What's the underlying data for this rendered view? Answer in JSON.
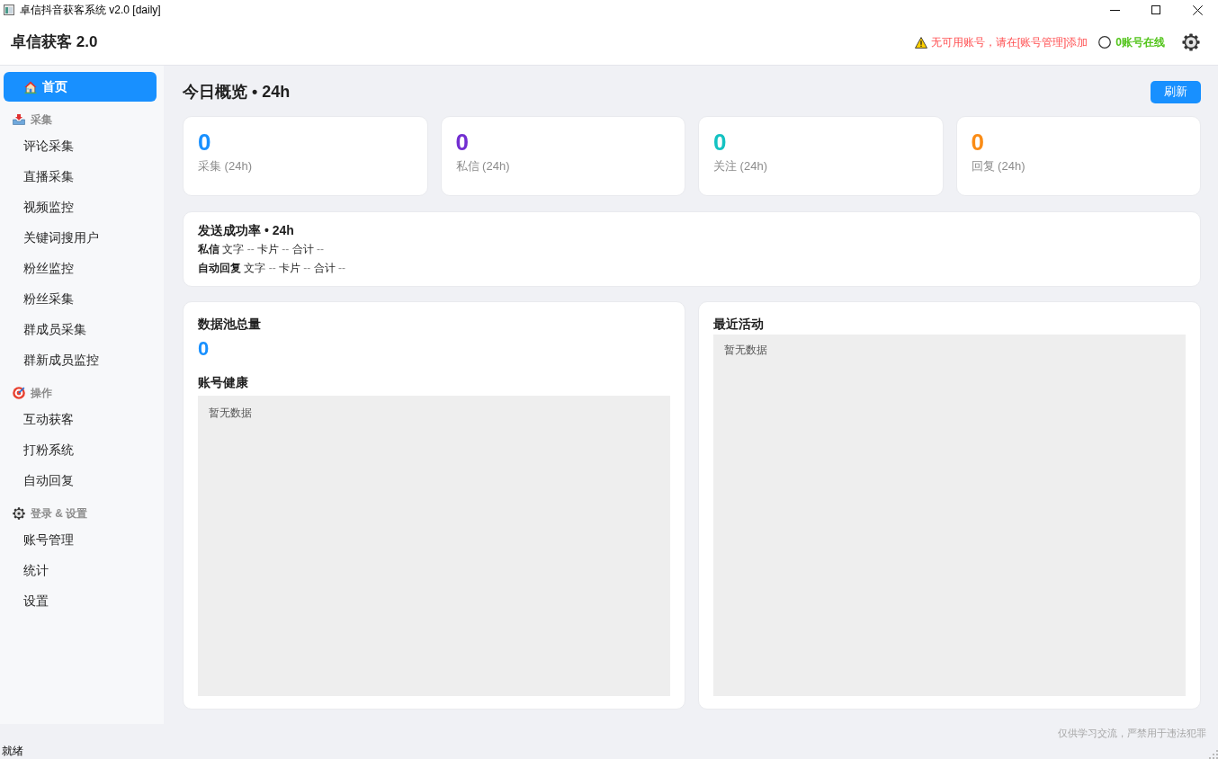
{
  "window": {
    "title": "卓信抖音获客系统 v2.0 [daily]"
  },
  "header": {
    "app_title": "卓信获客 2.0",
    "warning": "无可用账号，请在[账号管理]添加",
    "online_status": "0账号在线"
  },
  "sidebar": {
    "home": {
      "label": "首页",
      "selected": true
    },
    "sections": [
      {
        "title": "采集",
        "items": [
          {
            "label": "评论采集",
            "selected": false
          },
          {
            "label": "直播采集",
            "selected": false
          },
          {
            "label": "视频监控",
            "selected": false
          },
          {
            "label": "关键词搜用户",
            "selected": false
          },
          {
            "label": "粉丝监控",
            "selected": false
          },
          {
            "label": "粉丝采集",
            "selected": false
          },
          {
            "label": "群成员采集",
            "selected": false
          },
          {
            "label": "群新成员监控",
            "selected": false
          }
        ]
      },
      {
        "title": "操作",
        "items": [
          {
            "label": "互动获客",
            "selected": false
          },
          {
            "label": "打粉系统",
            "selected": false
          },
          {
            "label": "自动回复",
            "selected": false
          }
        ]
      },
      {
        "title": "登录 & 设置",
        "items": [
          {
            "label": "账号管理",
            "selected": false
          },
          {
            "label": "统计",
            "selected": false
          },
          {
            "label": "设置",
            "selected": false
          }
        ]
      }
    ]
  },
  "overview": {
    "title": "今日概览 • 24h",
    "refresh_button": "刷新",
    "stats": [
      {
        "value": "0",
        "label": "采集 (24h)",
        "color": "#1890ff"
      },
      {
        "value": "0",
        "label": "私信 (24h)",
        "color": "#722ed1"
      },
      {
        "value": "0",
        "label": "关注 (24h)",
        "color": "#13c2c2"
      },
      {
        "value": "0",
        "label": "回复 (24h)",
        "color": "#fa8c16"
      }
    ]
  },
  "send_success_rate": {
    "title": "发送成功率 • 24h",
    "rows": [
      {
        "label": "私信",
        "metrics": [
          {
            "name": "文字",
            "value": "--"
          },
          {
            "name": "卡片",
            "value": "--"
          },
          {
            "name": "合计",
            "value": "--"
          }
        ]
      },
      {
        "label": "自动回复",
        "metrics": [
          {
            "name": "文字",
            "value": "--"
          },
          {
            "name": "卡片",
            "value": "--"
          },
          {
            "name": "合计",
            "value": "--"
          }
        ]
      }
    ]
  },
  "data_pool": {
    "title": "数据池总量",
    "value": "0"
  },
  "account_health": {
    "title": "账号健康",
    "empty_text": "暂无数据"
  },
  "recent_activity": {
    "title": "最近活动",
    "empty_text": "暂无数据"
  },
  "footer": {
    "disclaimer": "仅供学习交流，严禁用于违法犯罪"
  },
  "status_bar": {
    "text": "就绪"
  }
}
